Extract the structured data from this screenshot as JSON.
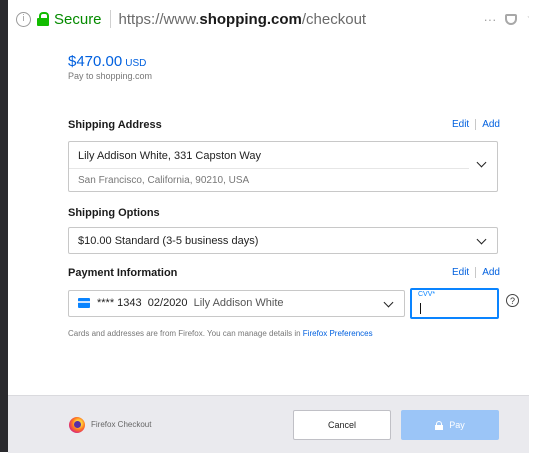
{
  "urlbar": {
    "secure_label": "Secure",
    "url_prefix": "https://www.",
    "url_domain": "shopping.com",
    "url_path": "/checkout",
    "more_label": "···",
    "star_glyph": "☆"
  },
  "payment_request": {
    "amount": "$470.00",
    "currency": "USD",
    "pay_to": "Pay to shopping.com"
  },
  "shipping_address": {
    "title": "Shipping Address",
    "edit_label": "Edit",
    "add_label": "Add",
    "line1": "Lily Addison White, 331 Capston Way",
    "line2": "San Francisco, California, 90210, USA"
  },
  "shipping_options": {
    "title": "Shipping Options",
    "selected": "$10.00 Standard (3-5 business days)"
  },
  "payment_info": {
    "title": "Payment Information",
    "edit_label": "Edit",
    "add_label": "Add",
    "card_number": "**** 1343",
    "card_expiry": "02/2020",
    "card_name": "Lily Addison White",
    "cvv_label": "CVV*",
    "help_glyph": "?"
  },
  "footnote": {
    "text": "Cards and addresses are from Firefox. You can manage details in ",
    "link": "Firefox Preferences"
  },
  "footer": {
    "brand": "Firefox Checkout",
    "cancel_label": "Cancel",
    "pay_label": "Pay"
  },
  "colors": {
    "accent": "#0060df",
    "focus": "#0a84ff",
    "secure": "#12bc00",
    "pay_disabled": "#9bc5f7",
    "footer_bg": "#eaeaee"
  }
}
